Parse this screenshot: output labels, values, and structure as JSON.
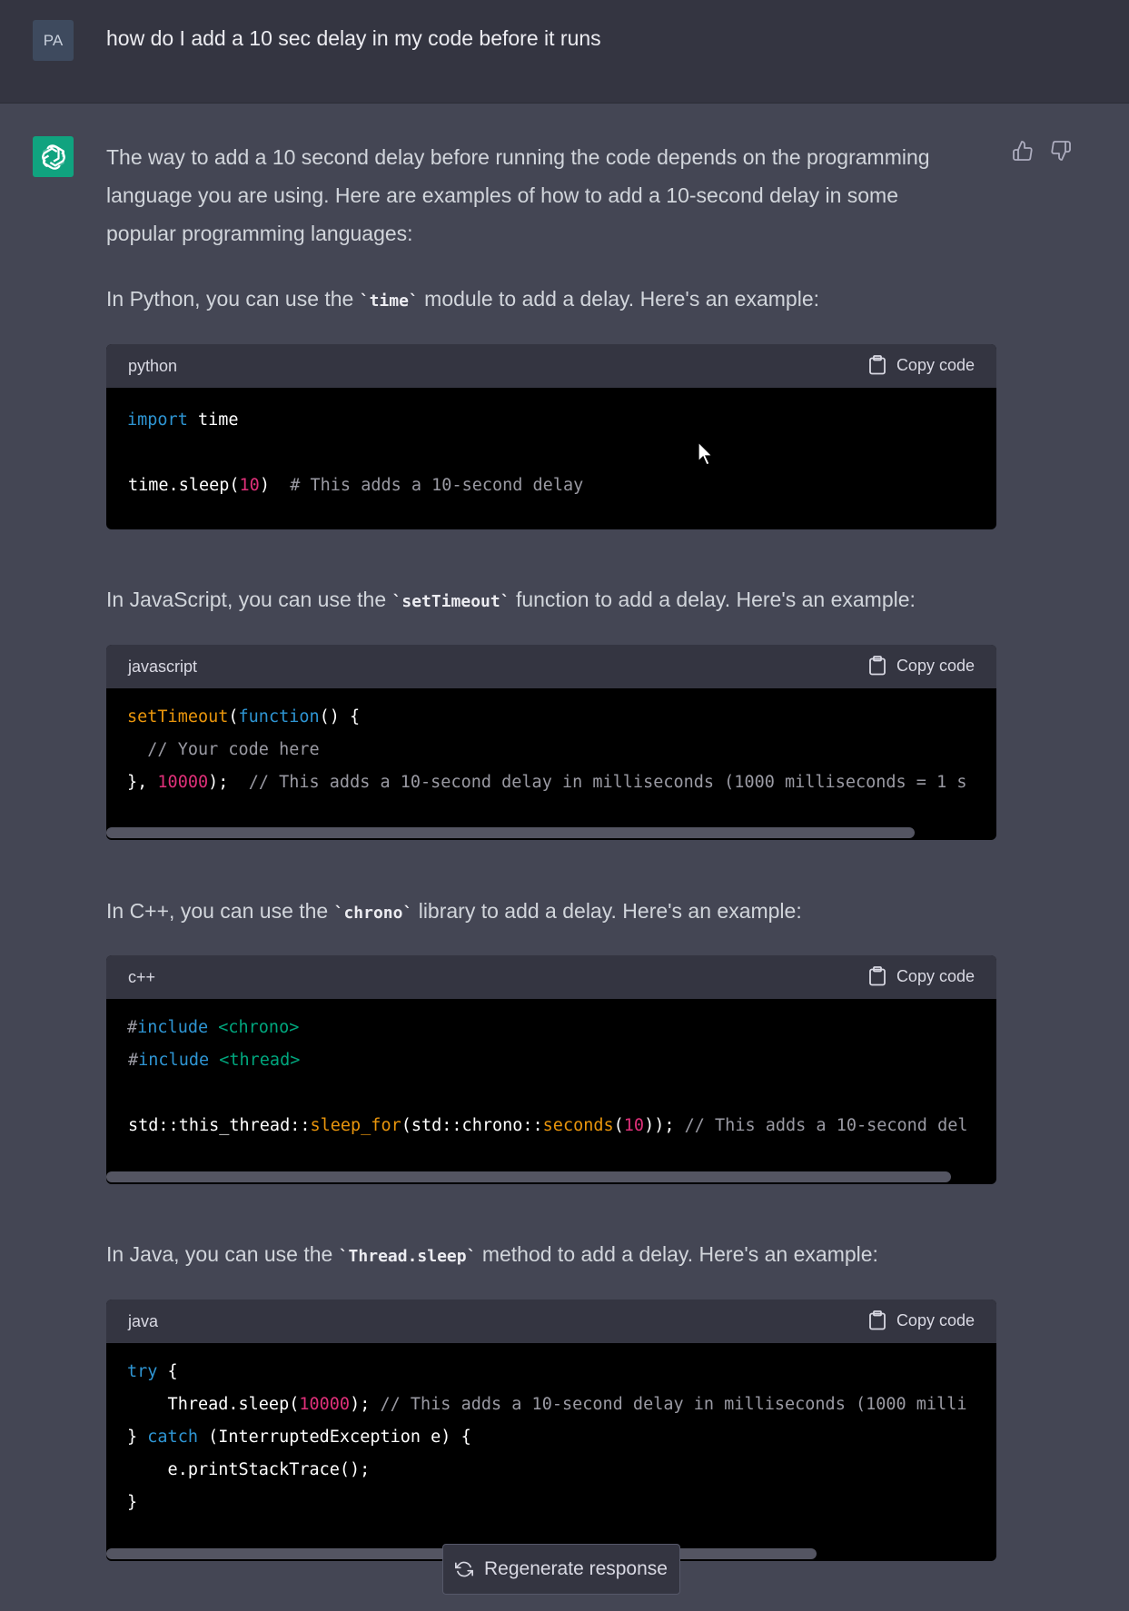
{
  "user": {
    "avatar_initials": "PA",
    "message": "how do I add a 10 sec delay in my code before it runs"
  },
  "assistant": {
    "intro_lines": [
      "The way to add a 10 second delay before running the code depends on the programming",
      "language you are using. Here are examples of how to add a 10-second delay in some",
      "popular programming languages:"
    ],
    "python_intro": {
      "pre": "In Python, you can use the ",
      "code": "`time`",
      "post": " module to add a delay. Here's an example:"
    },
    "js_intro": {
      "pre": "In JavaScript, you can use the ",
      "code": "`setTimeout`",
      "post": " function to add a delay. Here's an example:"
    },
    "cpp_intro": {
      "pre": "In C++, you can use the ",
      "code": "`chrono`",
      "post": " library to add a delay. Here's an example:"
    },
    "java_intro": {
      "pre": "In Java, you can use the ",
      "code": "`Thread.sleep`",
      "post": " method to add a delay. Here's an example:"
    }
  },
  "copy_label": "Copy code",
  "code_blocks": {
    "python": {
      "lang": "python",
      "import_kw": "import",
      "import_mod": " time",
      "line2_a": "time.sleep(",
      "line2_num": "10",
      "line2_b": ")  ",
      "line2_cm": "# This adds a 10-second delay"
    },
    "javascript": {
      "lang": "javascript",
      "l1_fn": "setTimeout",
      "l1_a": "(",
      "l1_kw": "function",
      "l1_b": "() {",
      "l2_cm": "  // Your code here",
      "l3_a": "}, ",
      "l3_num": "10000",
      "l3_b": ");  ",
      "l3_cm": "// This adds a 10-second delay in milliseconds (1000 milliseconds = 1 s"
    },
    "cpp": {
      "lang": "c++",
      "l1_hash": "#",
      "l1_kw": "include",
      "l1_str": " <chrono>",
      "l2_hash": "#",
      "l2_kw": "include",
      "l2_str": " <thread>",
      "l3_a": "std::this_thread::",
      "l3_fn": "sleep_for",
      "l3_b": "(std::chrono::",
      "l3_fn2": "seconds",
      "l3_c": "(",
      "l3_num": "10",
      "l3_d": ")); ",
      "l3_cm": "// This adds a 10-second del"
    },
    "java": {
      "lang": "java",
      "l1_kw": "try",
      "l1_a": " {",
      "l2_a": "    Thread.sleep(",
      "l2_num": "10000",
      "l2_b": "); ",
      "l2_cm": "// This adds a 10-second delay in milliseconds (1000 milli",
      "l3_a": "} ",
      "l3_kw": "catch",
      "l3_b": " (InterruptedException e) {",
      "l4": "    e.printStackTrace();",
      "l5": "}"
    }
  },
  "regenerate_label": "Regenerate response",
  "icons": [
    "thumbs-up-icon",
    "thumbs-down-icon",
    "clipboard-icon",
    "refresh-icon",
    "openai-logo",
    "mouse-cursor"
  ],
  "colors": {
    "accent": "#10a37f",
    "keyword": "#2e95d3",
    "number": "#df3079",
    "function": "#e9950c",
    "string": "#00a67d",
    "comment": "#9a9aa3"
  }
}
